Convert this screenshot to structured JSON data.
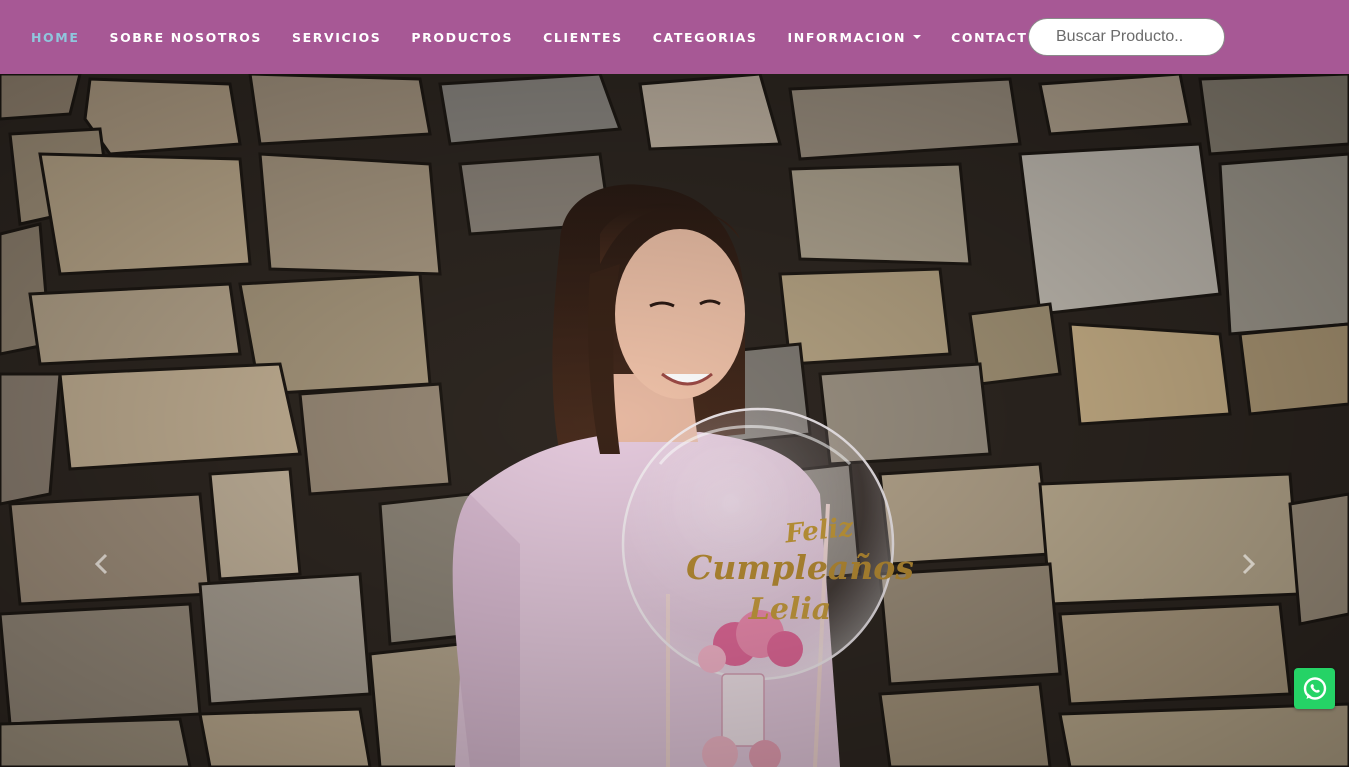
{
  "nav": {
    "items": [
      {
        "label": "HOME",
        "active": true
      },
      {
        "label": "SOBRE NOSOTROS"
      },
      {
        "label": "SERVICIOS"
      },
      {
        "label": "PRODUCTOS"
      },
      {
        "label": "CLIENTES"
      },
      {
        "label": "CATEGORIAS"
      },
      {
        "label": "INFORMACION",
        "dropdown": true
      },
      {
        "label": "CONTACTO"
      }
    ]
  },
  "search": {
    "placeholder": "Buscar Producto..",
    "value": ""
  },
  "hero": {
    "balloon_text": "Feliz Cumpleaños Lelia",
    "prev_icon": "chevron-left-icon",
    "next_icon": "chevron-right-icon"
  },
  "whatsapp": {
    "icon": "whatsapp-icon",
    "color": "#25d366"
  },
  "colors": {
    "navbar": "#a75895",
    "nav_text": "#ffffff",
    "nav_active": "#8fc7dd"
  }
}
